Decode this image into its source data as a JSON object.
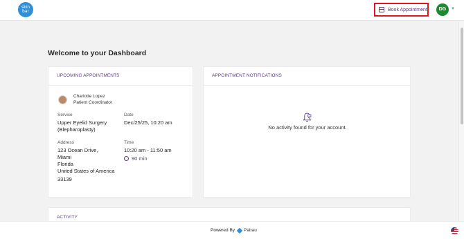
{
  "header": {
    "logo_text": "skin bar",
    "book_label": "Book Appointment",
    "avatar_initials": "DG"
  },
  "main": {
    "title": "Welcome to your Dashboard"
  },
  "upcoming": {
    "heading": "UPCOMING APPOINTMENTS",
    "coordinator_name": "Charlotte Lopez",
    "coordinator_role": "Patient Coordinator",
    "service_label": "Service",
    "service_line1": "Upper Eyelid Surgery",
    "service_line2": "(Blepharoplasty)",
    "date_label": "Date",
    "date_value": "Dec/25/25, 10:20 am",
    "address_label": "Address",
    "address_lines": [
      "123 Ocean Drive,",
      "Miami",
      "Florida",
      "United States of America",
      "33139"
    ],
    "time_label": "Time",
    "time_value": "10:20 am - 11:50 am",
    "duration": "90 min"
  },
  "notifications": {
    "heading": "APPOINTMENT NOTIFICATIONS",
    "empty_text": "No activity found for your account."
  },
  "activity": {
    "heading": "ACTIVITY"
  },
  "footer": {
    "powered_by": "Powered By",
    "brand": "Pabau"
  },
  "colors": {
    "accent": "#5a3a86",
    "highlight_border": "#e0141e",
    "avatar_bg": "#1c8a2f",
    "logo_bg": "#2f8fd8"
  },
  "icons": [
    "calendar-icon",
    "chevron-down-icon",
    "clock-icon",
    "bell-icon",
    "pabau-logo-icon",
    "us-flag-icon"
  ]
}
